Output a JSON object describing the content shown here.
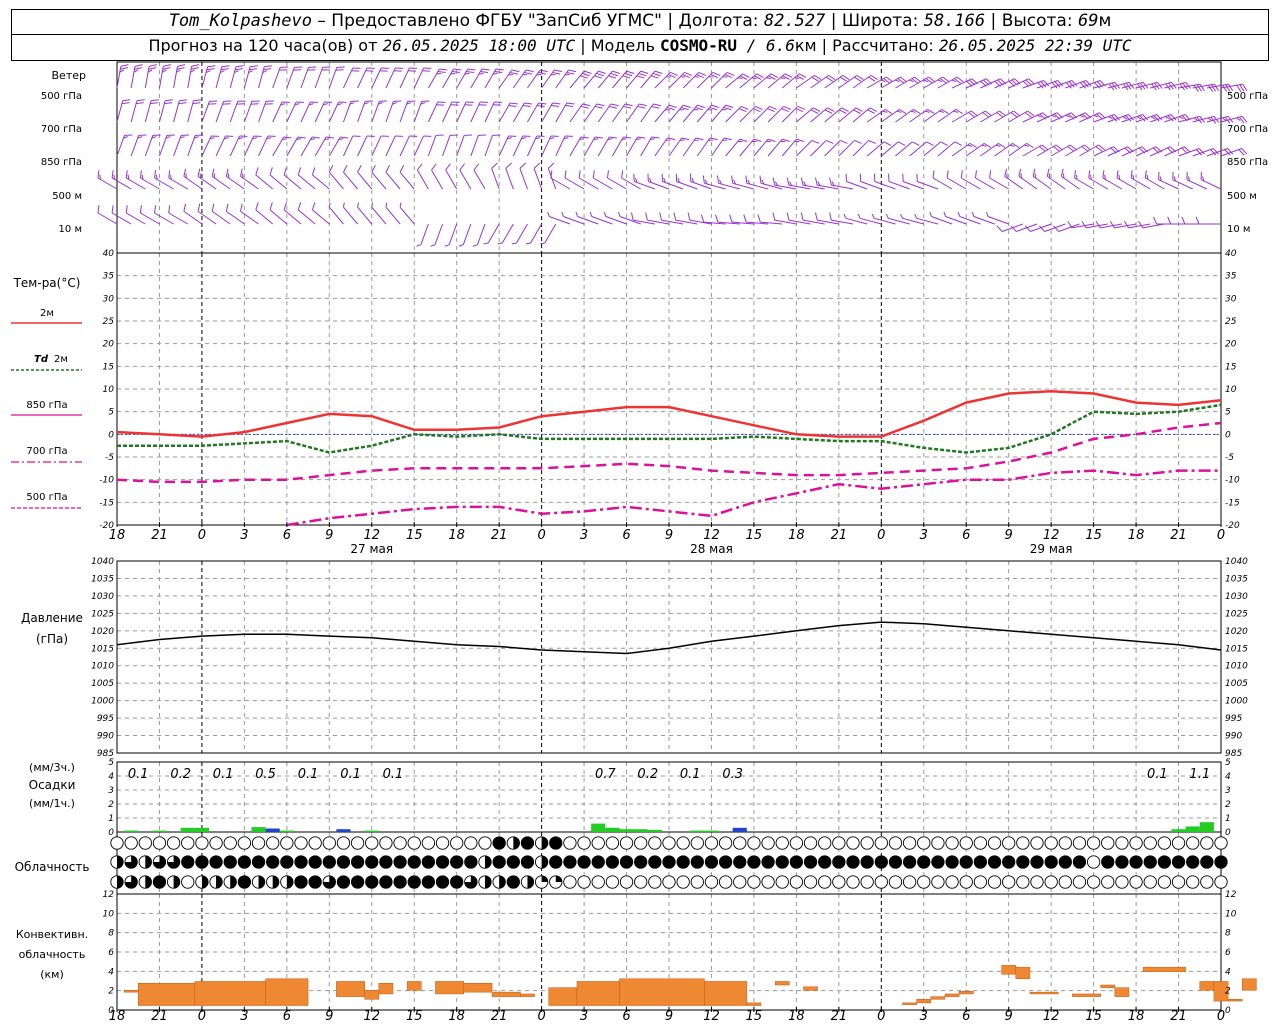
{
  "header": {
    "station": "Tom_Kolpashevo",
    "dash": " – ",
    "provider": "Предоставлено ФГБУ \"ЗапСиб УГМС\"",
    "sep": " | ",
    "lon_label": "Долгота: ",
    "lon": "82.527",
    "lat_label": "Широта: ",
    "lat": "58.166",
    "alt_label": "Высота: ",
    "alt": "69",
    "alt_unit": "м",
    "forecast_prefix": "Прогноз на 120 часа(ов) от ",
    "forecast_time": "26.05.2025 18:00 UTC",
    "model_label": "Модель ",
    "model": "COSMO-RU",
    "model_res": " / 6.6",
    "model_res_unit": "км",
    "calc_label": "Рассчитано: ",
    "calc_time": "26.05.2025 22:39 UTC"
  },
  "labels": {
    "wind_title": "Ветер",
    "wind_levels": [
      "500 гПа",
      "700 гПа",
      "850 гПа",
      "500 м",
      "10 м"
    ],
    "temp_title": "Тем-ра(°С)",
    "temp_2m": "2м",
    "td_symbol": "Td",
    "td_2m": "2м",
    "t850": "850 гПа",
    "t700": "700 гПа",
    "t500": "500 гПа",
    "pres_title": "Давление",
    "pres_unit": "(гПа)",
    "precip_top": "(мм/3ч.)",
    "precip_title": "Осадки",
    "precip_unit": "(мм/1ч.)",
    "cloud_title": "Облачность",
    "conv_title1": "Конвективн.",
    "conv_title2": "облачность",
    "conv_unit": "(км)"
  },
  "colors": {
    "t2m": "#ee3333",
    "td2m": "#227722",
    "t850": "#dd1199",
    "t700": "#dd1199",
    "t500": "#dd1199",
    "wind": "#9933cc",
    "pressure": "#000000",
    "precip_green": "#22cc22",
    "precip_blue": "#2244cc",
    "convective": "#ee8833",
    "grid": "#9a9a9a"
  },
  "time_axis": {
    "hour_labels": [
      "18",
      "21",
      "0",
      "3",
      "6",
      "9",
      "12",
      "15",
      "18",
      "21",
      "0",
      "3",
      "6",
      "9",
      "12",
      "15",
      "18",
      "21",
      "0",
      "3",
      "6",
      "9",
      "12",
      "15",
      "18",
      "21",
      "0"
    ],
    "day_labels": [
      {
        "text": "27 мая",
        "hour": 18
      },
      {
        "text": "28 мая",
        "hour": 42
      },
      {
        "text": "29 мая",
        "hour": 66
      }
    ]
  },
  "chart_data": [
    {
      "type": "line",
      "name": "temperature",
      "ylim": [
        -20,
        40
      ],
      "yticks": [
        "40",
        "35",
        "30",
        "25",
        "20",
        "15",
        "10",
        "5",
        "0",
        "-5",
        "-10",
        "-15",
        "-20"
      ],
      "x_hours": [
        0,
        3,
        6,
        9,
        12,
        15,
        18,
        21,
        24,
        27,
        30,
        33,
        36,
        39,
        42,
        45,
        48,
        51,
        54,
        57,
        60,
        63,
        66,
        69,
        72,
        75,
        78
      ],
      "series": [
        {
          "key": "t2m",
          "values": [
            0.5,
            0,
            -0.5,
            0.5,
            2.5,
            4.5,
            4,
            1,
            1,
            1.5,
            4,
            5,
            6,
            6,
            4,
            2,
            0,
            -0.5,
            -0.5,
            3,
            7,
            9,
            9.5,
            9,
            7,
            6.5,
            7.5
          ]
        },
        {
          "key": "td2m",
          "values": [
            -2.5,
            -2.5,
            -2.5,
            -2,
            -1.5,
            -4,
            -2.5,
            0,
            -0.5,
            0,
            -1,
            -1,
            -1,
            -1,
            -1,
            -0.5,
            -1,
            -1.5,
            -1.5,
            -3,
            -4,
            -3,
            0,
            5,
            4.5,
            5,
            6.5
          ]
        },
        {
          "key": "t850",
          "values": [
            -10,
            -10.5,
            -10.5,
            -10,
            -10,
            -9,
            -8,
            -7.5,
            -7.5,
            -7.5,
            -7.5,
            -7,
            -6.5,
            -7,
            -8,
            -8.5,
            -9,
            -9,
            -8.5,
            -8,
            -7.5,
            -6,
            -4,
            -1,
            0,
            1.5,
            2.5
          ]
        },
        {
          "key": "t700",
          "values": [
            null,
            null,
            null,
            null,
            -20,
            -18.5,
            -17.5,
            -16.5,
            -16,
            -16,
            -17.5,
            -17,
            -16,
            -17,
            -18,
            -15,
            -13,
            -11,
            -12,
            -11,
            -10,
            -10,
            -8.5,
            -8,
            -9,
            -8,
            -8
          ]
        }
      ]
    },
    {
      "type": "line",
      "name": "pressure",
      "ylim": [
        985,
        1040
      ],
      "yticks": [
        "1040",
        "1035",
        "1030",
        "1025",
        "1020",
        "1015",
        "1010",
        "1005",
        "1000",
        "995",
        "990",
        "985"
      ],
      "x_hours": [
        0,
        3,
        6,
        9,
        12,
        15,
        18,
        21,
        24,
        27,
        30,
        33,
        36,
        39,
        42,
        45,
        48,
        51,
        54,
        57,
        60,
        63,
        66,
        69,
        72,
        75,
        78
      ],
      "values": [
        1016,
        1017.5,
        1018.5,
        1019,
        1019,
        1018.5,
        1018,
        1017,
        1016,
        1015.5,
        1014.5,
        1014,
        1013.5,
        1015,
        1017,
        1018.5,
        1020,
        1021.5,
        1022.5,
        1022,
        1021,
        1020,
        1019,
        1018,
        1017,
        1016,
        1014.5
      ]
    },
    {
      "type": "bar",
      "name": "precipitation",
      "ylim": [
        0,
        5
      ],
      "yticks": [
        "5",
        "4",
        "3",
        "2",
        "1",
        "0"
      ],
      "totals": [
        {
          "text": "0.1",
          "hour": 1.5
        },
        {
          "text": "0.2",
          "hour": 4.5
        },
        {
          "text": "0.1",
          "hour": 7.5
        },
        {
          "text": "0.5",
          "hour": 10.5
        },
        {
          "text": "0.1",
          "hour": 13.5
        },
        {
          "text": "0.1",
          "hour": 16.5
        },
        {
          "text": "0.1",
          "hour": 19.5
        },
        {
          "text": "0.7",
          "hour": 34.5
        },
        {
          "text": "0.2",
          "hour": 37.5
        },
        {
          "text": "0.1",
          "hour": 40.5
        },
        {
          "text": "0.3",
          "hour": 43.5
        },
        {
          "text": "0.1",
          "hour": 73.5
        },
        {
          "text": "1.1",
          "hour": 76.5
        }
      ],
      "bars": [
        {
          "hour": 1,
          "value": 0.1,
          "c": "g"
        },
        {
          "hour": 3,
          "value": 0.1,
          "c": "g"
        },
        {
          "hour": 5,
          "value": 0.3,
          "c": "g"
        },
        {
          "hour": 6,
          "value": 0.3,
          "c": "g"
        },
        {
          "hour": 10,
          "value": 0.35,
          "c": "g"
        },
        {
          "hour": 11,
          "value": 0.25,
          "c": "b"
        },
        {
          "hour": 12,
          "value": 0.1,
          "c": "g"
        },
        {
          "hour": 16,
          "value": 0.2,
          "c": "b"
        },
        {
          "hour": 18,
          "value": 0.1,
          "c": "g"
        },
        {
          "hour": 34,
          "value": 0.6,
          "c": "g"
        },
        {
          "hour": 35,
          "value": 0.3,
          "c": "g"
        },
        {
          "hour": 36,
          "value": 0.2,
          "c": "g"
        },
        {
          "hour": 37,
          "value": 0.2,
          "c": "g"
        },
        {
          "hour": 38,
          "value": 0.15,
          "c": "g"
        },
        {
          "hour": 41,
          "value": 0.1,
          "c": "g"
        },
        {
          "hour": 42,
          "value": 0.1,
          "c": "g"
        },
        {
          "hour": 44,
          "value": 0.3,
          "c": "b"
        },
        {
          "hour": 75,
          "value": 0.2,
          "c": "g"
        },
        {
          "hour": 76,
          "value": 0.4,
          "c": "g"
        },
        {
          "hour": 77,
          "value": 0.7,
          "c": "g"
        }
      ]
    },
    {
      "type": "bar",
      "name": "convective_cloud",
      "ylim": [
        0,
        13
      ],
      "yticks": [
        "12",
        "10",
        "8",
        "6",
        "4",
        "2",
        "0"
      ],
      "segments": [
        {
          "start": 0.5,
          "end": 1.5,
          "base": 2,
          "top": 2.2
        },
        {
          "start": 1.5,
          "end": 5.5,
          "base": 0.5,
          "top": 3
        },
        {
          "start": 5.5,
          "end": 10.5,
          "base": 0.5,
          "top": 3.2
        },
        {
          "start": 10.5,
          "end": 13.5,
          "base": 0.5,
          "top": 3.5
        },
        {
          "start": 15.5,
          "end": 17.5,
          "base": 1.5,
          "top": 3.2
        },
        {
          "start": 17.5,
          "end": 18.5,
          "base": 1.2,
          "top": 2.2
        },
        {
          "start": 18.5,
          "end": 19.5,
          "base": 1.8,
          "top": 3
        },
        {
          "start": 20.5,
          "end": 21.5,
          "base": 2.2,
          "top": 3.2
        },
        {
          "start": 22.5,
          "end": 24.5,
          "base": 1.8,
          "top": 3.2
        },
        {
          "start": 24.5,
          "end": 26.5,
          "base": 2,
          "top": 3
        },
        {
          "start": 26.5,
          "end": 28.5,
          "base": 1.5,
          "top": 2
        },
        {
          "start": 28.5,
          "end": 29.5,
          "base": 1.5,
          "top": 1.8
        },
        {
          "start": 30.5,
          "end": 32.5,
          "base": 0.5,
          "top": 2.5
        },
        {
          "start": 32.5,
          "end": 35.5,
          "base": 0.5,
          "top": 3.2
        },
        {
          "start": 35.5,
          "end": 41.5,
          "base": 0.5,
          "top": 3.5
        },
        {
          "start": 41.5,
          "end": 44.5,
          "base": 0.5,
          "top": 3.2
        },
        {
          "start": 44.5,
          "end": 45.5,
          "base": 0.5,
          "top": 0.8
        },
        {
          "start": 46.5,
          "end": 47.5,
          "base": 2.8,
          "top": 3.2
        },
        {
          "start": 48.5,
          "end": 49.5,
          "base": 2.2,
          "top": 2.6
        },
        {
          "start": 55.5,
          "end": 56.5,
          "base": 0.6,
          "top": 0.8
        },
        {
          "start": 56.5,
          "end": 57.5,
          "base": 0.8,
          "top": 1.2
        },
        {
          "start": 57.5,
          "end": 58.5,
          "base": 1.2,
          "top": 1.5
        },
        {
          "start": 58.5,
          "end": 59.5,
          "base": 1.5,
          "top": 1.8
        },
        {
          "start": 59.5,
          "end": 60.5,
          "base": 1.8,
          "top": 2.1
        },
        {
          "start": 62.5,
          "end": 63.5,
          "base": 4,
          "top": 5
        },
        {
          "start": 63.5,
          "end": 64.5,
          "base": 3.5,
          "top": 4.8
        },
        {
          "start": 64.5,
          "end": 66.5,
          "base": 1.8,
          "top": 2
        },
        {
          "start": 67.5,
          "end": 69.5,
          "base": 1.5,
          "top": 1.8
        },
        {
          "start": 69.5,
          "end": 70.5,
          "base": 2.5,
          "top": 2.8
        },
        {
          "start": 70.5,
          "end": 71.5,
          "base": 1.5,
          "top": 2.5
        },
        {
          "start": 72.5,
          "end": 75.5,
          "base": 4.3,
          "top": 4.8
        },
        {
          "start": 76.5,
          "end": 77.5,
          "base": 2.2,
          "top": 3.2
        },
        {
          "start": 77.5,
          "end": 78.5,
          "base": 1,
          "top": 3.2
        },
        {
          "start": 78.5,
          "end": 79.5,
          "base": 1,
          "top": 1.2
        },
        {
          "start": 79.5,
          "end": 80.5,
          "base": 2.2,
          "top": 3.5
        }
      ]
    }
  ],
  "clouds": {
    "hour_step": 1,
    "rows": [
      "0000000000000000000000000004242400000000000000000000000000000000000000000000000000000000000000000000000000000000000000000000000000000000000000000000000000000000000000000000000000000000000000000000000000000000000000000000000000000000000000000000000000000000000000000000000000000000000000000000000000000000000000000000000000000000000000000000",
      "2323344444444444444444444424442444444444444444444444444444444444444440444444444444444444444444444444444444444444444444444444444444444444444444444444444444444444444444444444444444444444444444444444444444444444444444444444444444444444444444444444444444444444444444444444444444444444444444444444444444444444444444444444444444444444444444444",
      "2324202224222443444444444322421100000000000000000000000000000000000000000000000000000000000000000000000000000000000000000000000000000000000000000000000000000000000000000000000000000000000000000000000000000000000000000000000000000000000000000000000000000000000000000000000000000000000000000000000000000000000000000000000000000000000000000"
    ]
  }
}
